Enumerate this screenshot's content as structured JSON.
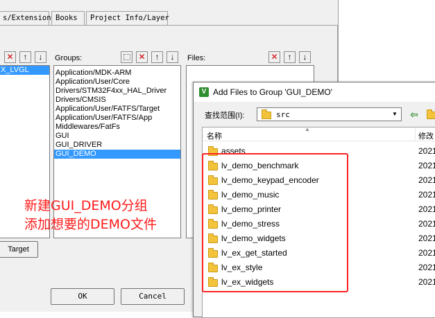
{
  "manage_dialog": {
    "tabs": [
      "s/Extensions",
      "Books",
      "Project Info/Layer"
    ],
    "targets": {
      "visible_item": "X_LVGL"
    },
    "groups": {
      "label": "Groups:",
      "items": [
        "Application/MDK-ARM",
        "Application/User/Core",
        "Drivers/STM32F4xx_HAL_Driver",
        "Drivers/CMSIS",
        "Application/User/FATFS/Target",
        "Application/User/FATFS/App",
        "Middlewares/FatFs",
        "GUI",
        "GUI_DRIVER",
        "GUI_DEMO"
      ],
      "selected_index": 9
    },
    "files": {
      "label": "Files:"
    },
    "set_target_button": "Target",
    "ok_button": "OK",
    "cancel_button": "Cancel",
    "toolbar_icons": [
      "new-icon",
      "delete-icon",
      "move-up-icon",
      "move-down-icon"
    ]
  },
  "annotation": {
    "line1": "新建GUI_DEMO分组",
    "line2": "添加想要的DEMO文件",
    "color": "#ff1a1a"
  },
  "add_files_dialog": {
    "title": "Add Files to Group 'GUI_DEMO'",
    "look_in_label": "查找范围(I):",
    "look_in_value": "src",
    "columns": {
      "name": "名称",
      "modified": "修改"
    },
    "folders": [
      {
        "name": "assets",
        "date": "2021"
      },
      {
        "name": "lv_demo_benchmark",
        "date": "2021"
      },
      {
        "name": "lv_demo_keypad_encoder",
        "date": "2021"
      },
      {
        "name": "lv_demo_music",
        "date": "2021"
      },
      {
        "name": "lv_demo_printer",
        "date": "2021"
      },
      {
        "name": "lv_demo_stress",
        "date": "2021"
      },
      {
        "name": "lv_demo_widgets",
        "date": "2021"
      },
      {
        "name": "lv_ex_get_started",
        "date": "2021"
      },
      {
        "name": "lv_ex_style",
        "date": "2021"
      },
      {
        "name": "lv_ex_widgets",
        "date": "2021"
      }
    ],
    "highlight_color": "#ff2020"
  }
}
